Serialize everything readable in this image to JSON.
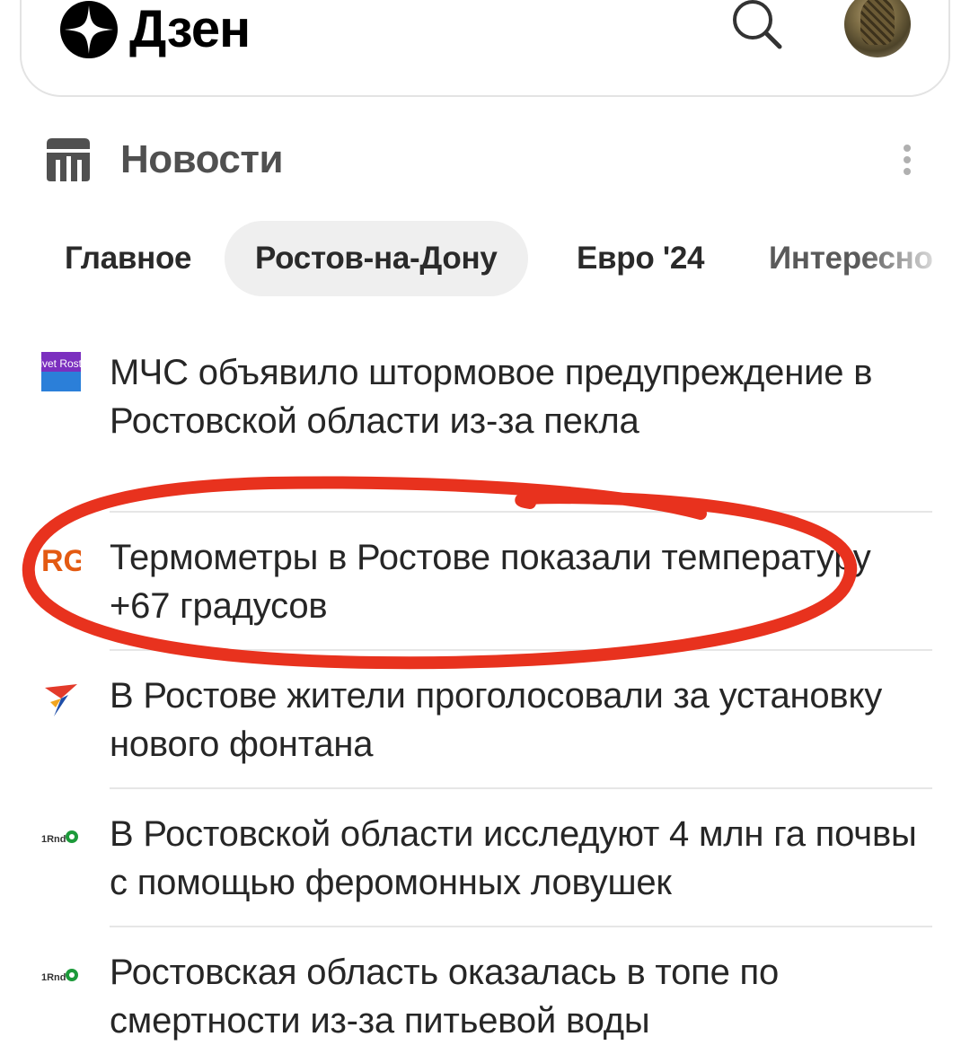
{
  "header": {
    "logo_text": "Дзен",
    "search_icon": "search-icon",
    "avatar": "user-avatar"
  },
  "section": {
    "title": "Новости",
    "icon": "news-icon",
    "more_icon": "kebab-menu-icon"
  },
  "tabs": [
    {
      "label": "Главное",
      "active": false
    },
    {
      "label": "Ростов-на-Дону",
      "active": true
    },
    {
      "label": "Евро '24",
      "active": false
    },
    {
      "label": "Интересно",
      "active": false
    }
  ],
  "news": [
    {
      "source_icon": "privet-rostov-logo",
      "source_logo_text": "Privet Rostov",
      "text": "МЧС объявило штормовое предупреждение в Ростовской области из-за пекла"
    },
    {
      "source_icon": "rg-logo",
      "source_logo_text": "RG",
      "text": "Термометры в Ростове показали температуру +67 градусов"
    },
    {
      "source_icon": "bird-logo",
      "text": "В Ростове жители проголосовали за установку нового фонтана"
    },
    {
      "source_icon": "1rnd-logo",
      "source_logo_text": "1Rnd",
      "text": "В Ростовской области исследуют 4 млн га почвы с помощью феромонных ловушек"
    },
    {
      "source_icon": "1rnd-logo",
      "source_logo_text": "1Rnd",
      "text": "Ростовская область оказалась в топе по смертности из-за питьевой воды"
    }
  ],
  "colors": {
    "annotation_circle": "#e8321e",
    "tab_active_bg": "#efefef",
    "text": "#262626",
    "section_title": "#505050"
  }
}
